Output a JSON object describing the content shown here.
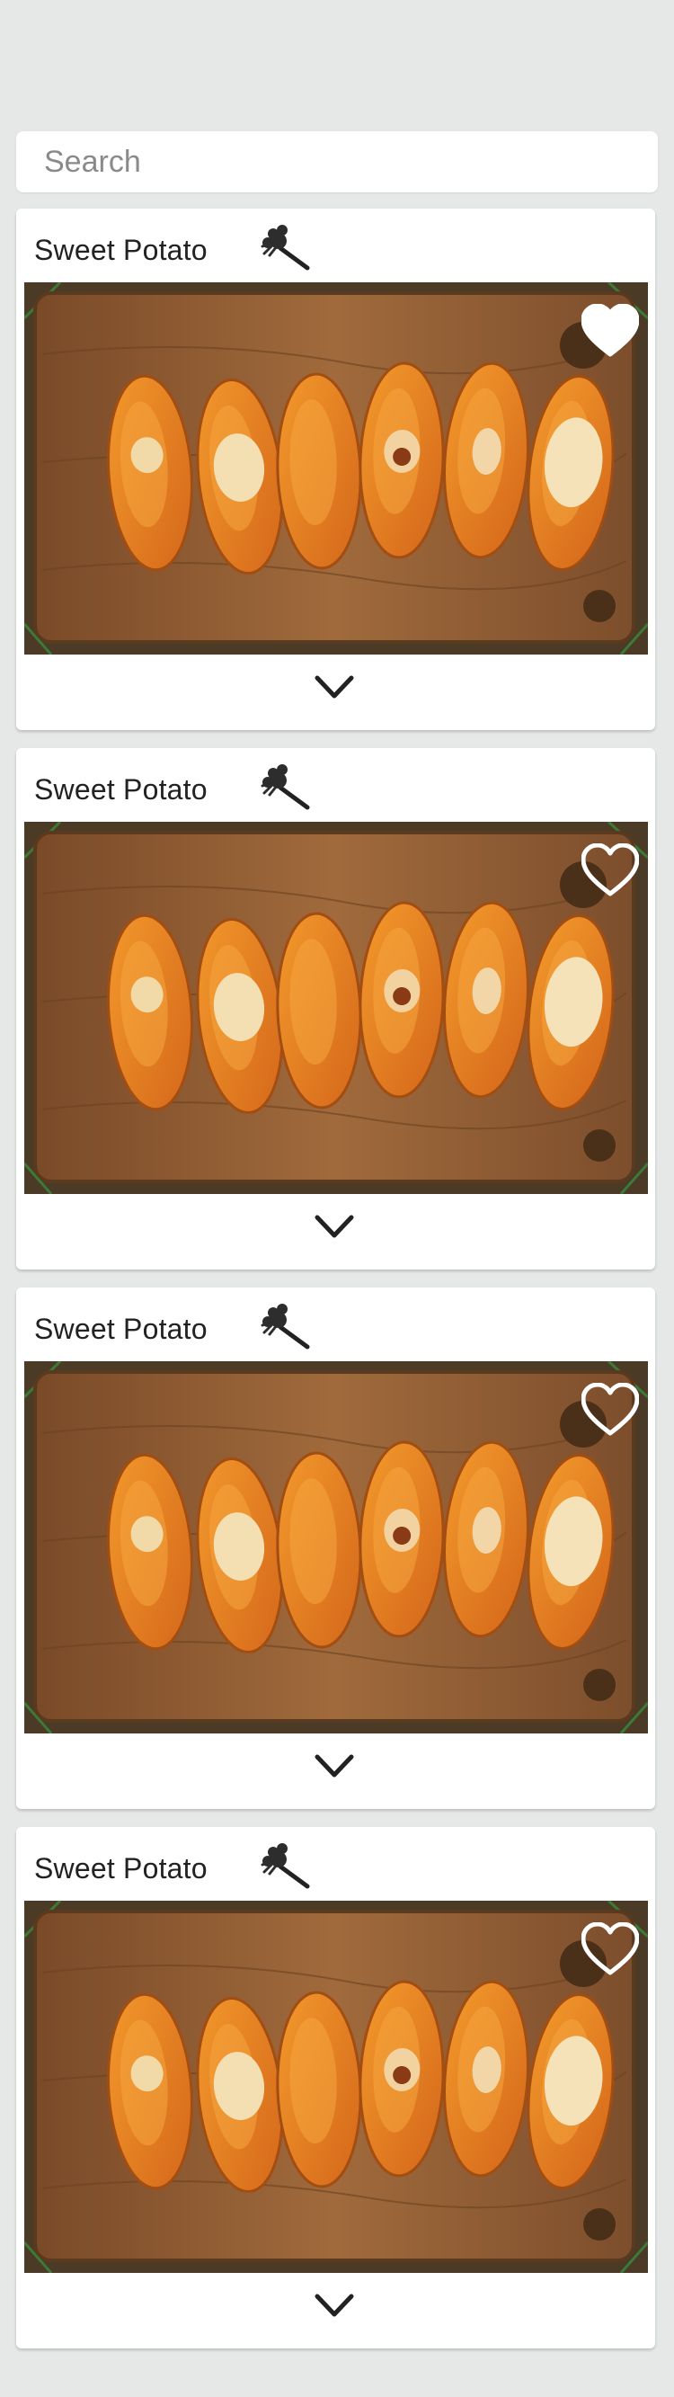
{
  "search": {
    "placeholder": "Search",
    "value": ""
  },
  "cards": [
    {
      "title": "Sweet Potato",
      "favorite": true,
      "icon": "rake-tool-icon"
    },
    {
      "title": "Sweet Potato",
      "favorite": false,
      "icon": "rake-tool-icon"
    },
    {
      "title": "Sweet Potato",
      "favorite": false,
      "icon": "rake-tool-icon"
    },
    {
      "title": "Sweet Potato",
      "favorite": false,
      "icon": "rake-tool-icon"
    }
  ],
  "colors": {
    "background": "#e6e8e8",
    "card": "#ffffff",
    "text": "#222222",
    "potato": "#e07a1f",
    "board": "#8a5a32"
  }
}
